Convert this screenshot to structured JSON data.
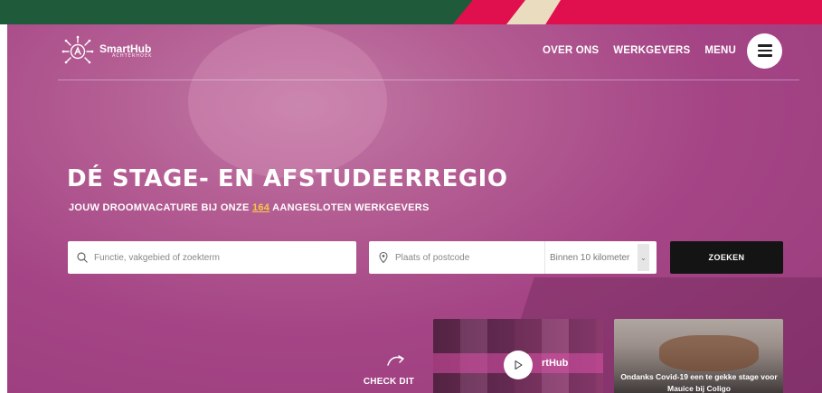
{
  "brand": {
    "logo_name": "SmartHub",
    "logo_sub": "ACHTERHOEK"
  },
  "nav": {
    "items": [
      "OVER ONS",
      "WERKGEVERS",
      "MENU"
    ],
    "menu_icon": "hamburger-icon"
  },
  "hero": {
    "title": "DÉ STAGE- EN AFSTUDEERREGIO",
    "subtitle_before": "JOUW DROOMVACATURE BIJ ONZE ",
    "employer_count": "164",
    "subtitle_after": " AANGESLOTEN WERKGEVERS"
  },
  "search": {
    "query_placeholder": "Functie, vakgebied of zoekterm",
    "query_icon": "search-icon",
    "location_placeholder": "Plaats of postcode",
    "location_icon": "map-pin-icon",
    "radius_value": "Binnen 10 kilometer",
    "submit_label": "ZOEKEN"
  },
  "teasers": {
    "check_label": "CHECK DIT",
    "video_brand": "rtHub",
    "news_caption": "Ondanks Covid-19 een te gekke stage voor Mauice bij Coligo"
  },
  "colors": {
    "hero_magenta": "#a54586",
    "accent_yellow": "#f7c843",
    "top_green": "#1f5a3b",
    "top_red": "#e0104e",
    "button_dark": "#141414"
  }
}
